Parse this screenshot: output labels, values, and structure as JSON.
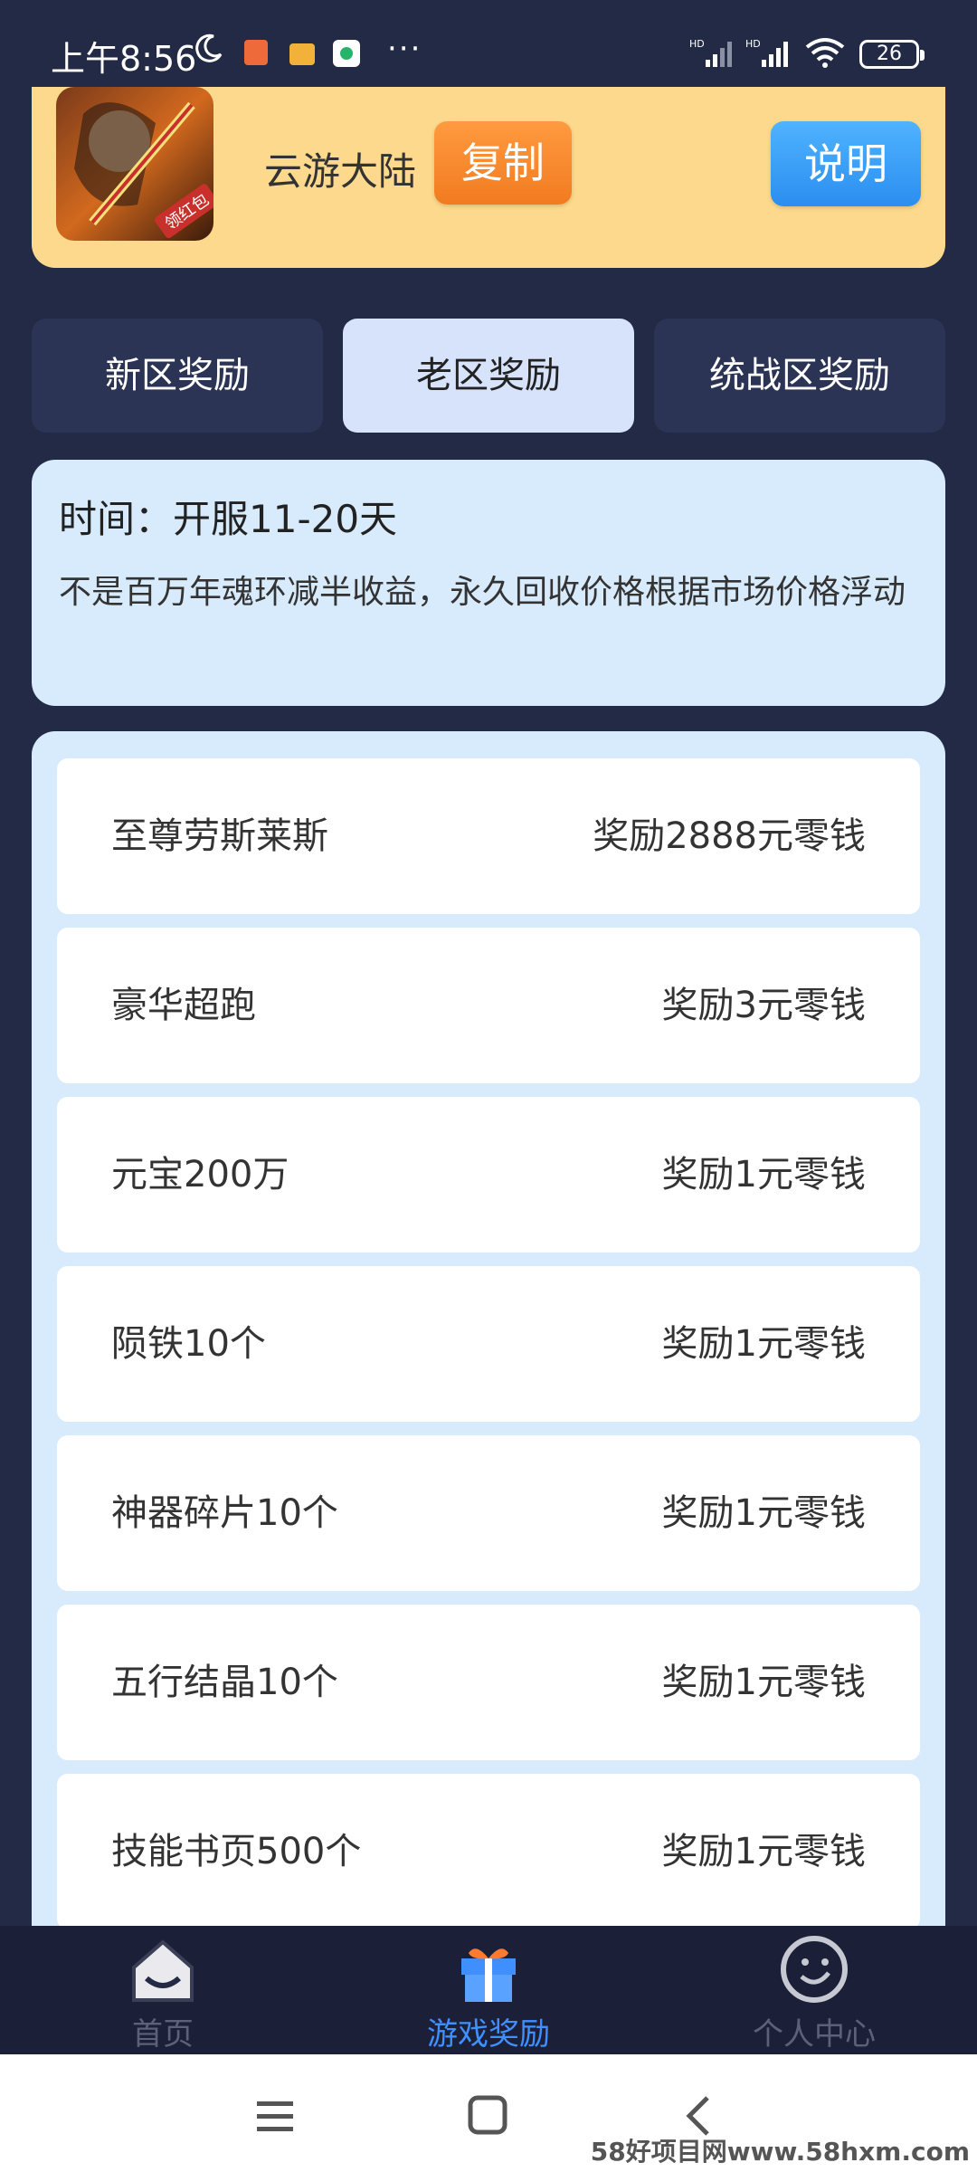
{
  "status_bar": {
    "time": "上午8:56",
    "battery": "26",
    "more": "···"
  },
  "game": {
    "name": "云游大陆",
    "icon_badge": "领红包",
    "copy_label": "复制",
    "explain_label": "说明"
  },
  "tabs": [
    {
      "label": "新区奖励",
      "active": false
    },
    {
      "label": "老区奖励",
      "active": true
    },
    {
      "label": "统战区奖励",
      "active": false
    }
  ],
  "info": {
    "time": "时间：开服11-20天",
    "desc": "不是百万年魂环减半收益，永久回收价格根据市场价格浮动"
  },
  "rewards": [
    {
      "name": "至尊劳斯莱斯",
      "value": "奖励2888元零钱"
    },
    {
      "name": "豪华超跑",
      "value": "奖励3元零钱"
    },
    {
      "name": "元宝200万",
      "value": "奖励1元零钱"
    },
    {
      "name": "陨铁10个",
      "value": "奖励1元零钱"
    },
    {
      "name": "神器碎片10个",
      "value": "奖励1元零钱"
    },
    {
      "name": "五行结晶10个",
      "value": "奖励1元零钱"
    },
    {
      "name": "技能书页500个",
      "value": "奖励1元零钱"
    }
  ],
  "bottom_nav": [
    {
      "label": "首页",
      "icon": "home-icon"
    },
    {
      "label": "游戏奖励",
      "icon": "gift-icon"
    },
    {
      "label": "个人中心",
      "icon": "smiley-icon"
    }
  ],
  "colors": {
    "background": "#232a45",
    "card_yellow": "#fcd98c",
    "copy_orange": "#f27b20",
    "explain_blue": "#2b8ef0",
    "active_tab": "#d6e3fb",
    "panel_light_blue": "#d7ebfc",
    "nav_active": "#3f8fff"
  },
  "watermark": "58好项目网www.58hxm.com"
}
